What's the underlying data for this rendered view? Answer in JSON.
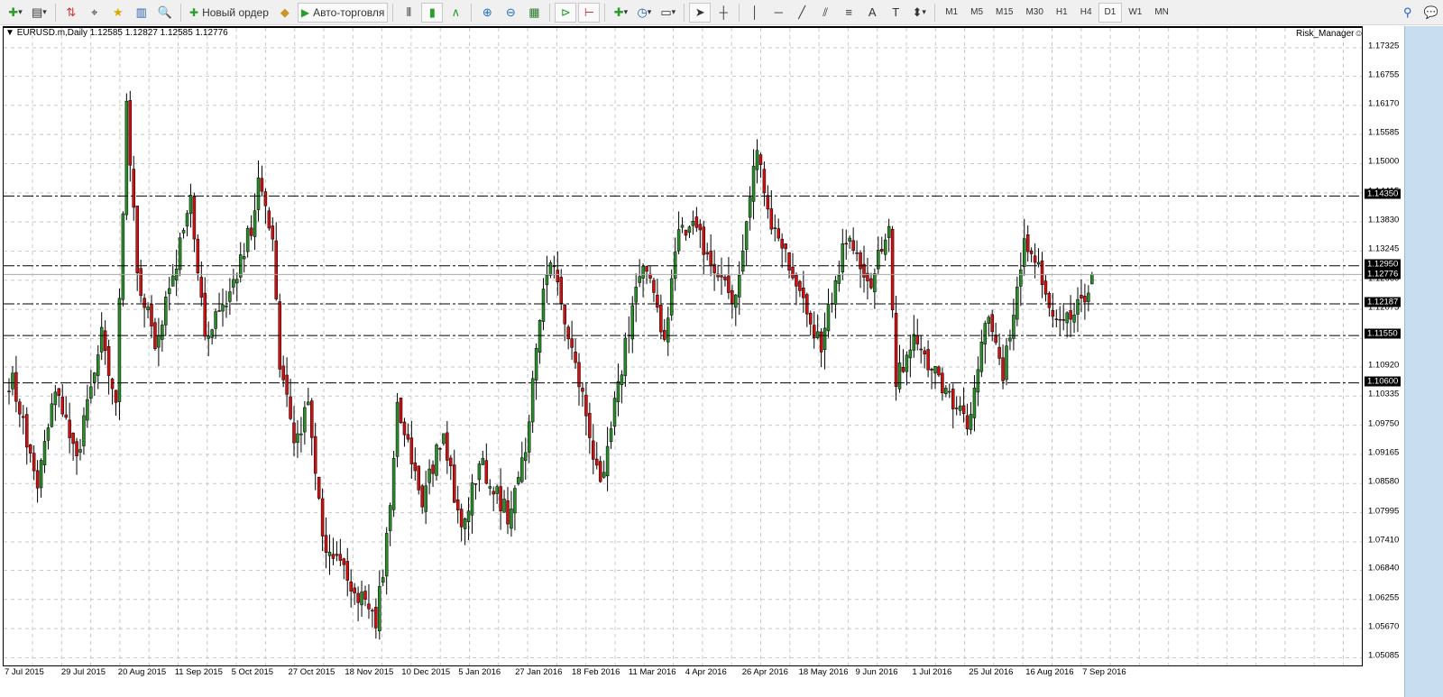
{
  "toolbar": {
    "items": [
      {
        "name": "new-chart-button",
        "icon": "plus-icon",
        "glyph": "✚",
        "color": "#2a9d2a",
        "dropdown": true
      },
      {
        "name": "profiles-button",
        "icon": "profiles-icon",
        "glyph": "▤",
        "dropdown": true
      },
      {
        "sep": true
      },
      {
        "name": "market-watch-button",
        "icon": "market-watch-icon",
        "glyph": "⇅",
        "color": "#c33"
      },
      {
        "name": "data-window-button",
        "icon": "crosshair-icon",
        "glyph": "⌖"
      },
      {
        "name": "navigator-button",
        "icon": "star-folder-icon",
        "glyph": "★",
        "color": "#d8a800"
      },
      {
        "name": "terminal-button",
        "icon": "terminal-icon",
        "glyph": "▥",
        "color": "#3060b0"
      },
      {
        "name": "strategy-tester-button",
        "icon": "tester-icon",
        "glyph": "🔍"
      },
      {
        "sep": true
      },
      {
        "name": "new-order-button",
        "icon": "new-order-icon",
        "glyph": "✚",
        "color": "#2a9d2a",
        "label": "Новый ордер"
      },
      {
        "name": "metaeditor-button",
        "icon": "book-icon",
        "glyph": "◆",
        "color": "#c8962a"
      },
      {
        "name": "auto-trading-button",
        "icon": "auto-trading-icon",
        "glyph": "▶",
        "color": "#2a9d2a",
        "label": "Авто-торговля",
        "active": true
      },
      {
        "sep": true
      },
      {
        "name": "bar-chart-button",
        "icon": "bar-chart-icon",
        "glyph": "⫴"
      },
      {
        "name": "candlestick-button",
        "icon": "candlestick-icon",
        "glyph": "▮",
        "color": "#2a9d2a",
        "active": true
      },
      {
        "name": "line-chart-button",
        "icon": "line-chart-icon",
        "glyph": "∧",
        "color": "#2a9d2a"
      },
      {
        "sep": true
      },
      {
        "name": "zoom-in-button",
        "icon": "zoom-in-icon",
        "glyph": "⊕",
        "color": "#2070c0"
      },
      {
        "name": "zoom-out-button",
        "icon": "zoom-out-icon",
        "glyph": "⊖",
        "color": "#2070c0"
      },
      {
        "name": "tile-windows-button",
        "icon": "tile-icon",
        "glyph": "▦",
        "color": "#2a7a2a"
      },
      {
        "sep": true
      },
      {
        "name": "autoscroll-button",
        "icon": "autoscroll-icon",
        "glyph": "⊳",
        "color": "#2a9d2a",
        "active": true
      },
      {
        "name": "chart-shift-button",
        "icon": "chart-shift-icon",
        "glyph": "⊢",
        "color": "#c33",
        "active": true
      },
      {
        "sep": true
      },
      {
        "name": "indicators-button",
        "icon": "indicators-icon",
        "glyph": "✚",
        "color": "#2a9d2a",
        "dropdown": true
      },
      {
        "name": "periods-button",
        "icon": "clock-icon",
        "glyph": "◷",
        "color": "#2060b0",
        "dropdown": true
      },
      {
        "name": "templates-button",
        "icon": "template-icon",
        "glyph": "▭",
        "dropdown": true
      },
      {
        "sep": true
      },
      {
        "name": "cursor-button",
        "icon": "cursor-icon",
        "glyph": "➤",
        "active": true
      },
      {
        "name": "crosshair-button",
        "icon": "crosshair-icon",
        "glyph": "┼"
      },
      {
        "sep": true
      },
      {
        "name": "vertical-line-button",
        "icon": "vertical-line-icon",
        "glyph": "│"
      },
      {
        "name": "horizontal-line-button",
        "icon": "horizontal-line-icon",
        "glyph": "─"
      },
      {
        "name": "trendline-button",
        "icon": "trendline-icon",
        "glyph": "╱"
      },
      {
        "name": "equidistant-channel-button",
        "icon": "channel-icon",
        "glyph": "⫽"
      },
      {
        "name": "fibonacci-button",
        "icon": "fibonacci-icon",
        "glyph": "≡"
      },
      {
        "name": "text-button",
        "icon": "text-icon",
        "glyph": "A"
      },
      {
        "name": "text-label-button",
        "icon": "text-label-icon",
        "glyph": "T"
      },
      {
        "name": "arrows-button",
        "icon": "arrows-icon",
        "glyph": "⬍",
        "dropdown": true
      }
    ],
    "timeframes": [
      "M1",
      "M5",
      "M15",
      "M30",
      "H1",
      "H4",
      "D1",
      "W1",
      "MN"
    ],
    "active_timeframe": "D1"
  },
  "chart": {
    "symbol_header": "EURUSD.m,Daily  1.12585 1.12827 1.12585 1.12776",
    "indicator_label": "Risk_Manager",
    "bull_color": "#2a8c2a",
    "bear_color": "#d01010"
  },
  "chart_data": {
    "type": "candlestick",
    "symbol": "EURUSD.m",
    "timeframe": "Daily",
    "last": {
      "open": 1.12585,
      "high": 1.12827,
      "low": 1.12585,
      "close": 1.12776
    },
    "ylim": [
      1.0485,
      1.1765
    ],
    "price_ticks": [
      "1.17325",
      "1.16755",
      "1.16170",
      "1.15585",
      "1.15000",
      "1.14415",
      "1.13830",
      "1.13245",
      "1.12660",
      "1.12075",
      "1.11490",
      "1.10920",
      "1.10335",
      "1.09750",
      "1.09165",
      "1.08580",
      "1.07995",
      "1.07410",
      "1.06840",
      "1.06255",
      "1.05670",
      "1.05085"
    ],
    "date_labels": [
      "7 Jul 2015",
      "29 Jul 2015",
      "20 Aug 2015",
      "11 Sep 2015",
      "5 Oct 2015",
      "27 Oct 2015",
      "18 Nov 2015",
      "10 Dec 2015",
      "5 Jan 2016",
      "27 Jan 2016",
      "18 Feb 2016",
      "11 Mar 2016",
      "4 Apr 2016",
      "26 Apr 2016",
      "18 May 2016",
      "9 Jun 2016",
      "1 Jul 2016",
      "25 Jul 2016",
      "16 Aug 2016",
      "7 Sep 2016"
    ],
    "level_lines": [
      {
        "price": "1.14350"
      },
      {
        "price": "1.12950"
      },
      {
        "price": "1.12187"
      },
      {
        "price": "1.11550"
      },
      {
        "price": "1.10600"
      }
    ],
    "bid_line": "1.12776",
    "close_anchors": [
      [
        0,
        1.105
      ],
      [
        1,
        1.1066
      ],
      [
        8,
        1.0849
      ],
      [
        13,
        1.1048
      ],
      [
        19,
        1.0903
      ],
      [
        26,
        1.1157
      ],
      [
        30,
        1.103
      ],
      [
        33,
        1.1609
      ],
      [
        36,
        1.1284
      ],
      [
        41,
        1.1139
      ],
      [
        47,
        1.1302
      ],
      [
        51,
        1.1428
      ],
      [
        55,
        1.1157
      ],
      [
        61,
        1.1211
      ],
      [
        68,
        1.1374
      ],
      [
        70,
        1.1465
      ],
      [
        74,
        1.1338
      ],
      [
        76,
        1.1103
      ],
      [
        80,
        1.094
      ],
      [
        84,
        1.1012
      ],
      [
        88,
        1.0741
      ],
      [
        93,
        1.0705
      ],
      [
        98,
        1.0632
      ],
      [
        103,
        1.0578
      ],
      [
        106,
        1.0741
      ],
      [
        109,
        1.1012
      ],
      [
        116,
        1.0831
      ],
      [
        122,
        1.0958
      ],
      [
        127,
        1.0759
      ],
      [
        132,
        1.0903
      ],
      [
        140,
        1.0795
      ],
      [
        145,
        1.0922
      ],
      [
        149,
        1.1193
      ],
      [
        152,
        1.132
      ],
      [
        156,
        1.1175
      ],
      [
        160,
        1.1066
      ],
      [
        166,
        1.0849
      ],
      [
        170,
        1.1012
      ],
      [
        175,
        1.1211
      ],
      [
        178,
        1.1302
      ],
      [
        184,
        1.1157
      ],
      [
        188,
        1.1356
      ],
      [
        192,
        1.1392
      ],
      [
        198,
        1.1266
      ],
      [
        204,
        1.123
      ],
      [
        210,
        1.1528
      ],
      [
        213,
        1.1392
      ],
      [
        219,
        1.1302
      ],
      [
        223,
        1.1211
      ],
      [
        228,
        1.1139
      ],
      [
        235,
        1.1356
      ],
      [
        241,
        1.1248
      ],
      [
        247,
        1.1374
      ],
      [
        249,
        1.1066
      ],
      [
        254,
        1.1139
      ],
      [
        261,
        1.1066
      ],
      [
        269,
        1.0976
      ],
      [
        275,
        1.1211
      ],
      [
        279,
        1.1084
      ],
      [
        285,
        1.1338
      ],
      [
        289,
        1.1302
      ],
      [
        294,
        1.1175
      ],
      [
        299,
        1.1193
      ],
      [
        303,
        1.12585
      ],
      [
        304,
        1.12776
      ]
    ]
  }
}
